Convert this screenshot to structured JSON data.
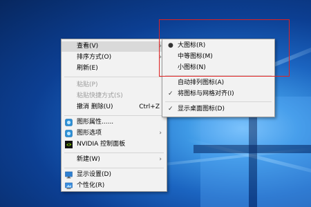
{
  "context_menu": {
    "items": [
      {
        "label": "查看(V)",
        "has_submenu": true,
        "highlighted": true
      },
      {
        "label": "排序方式(O)",
        "has_submenu": true
      },
      {
        "label": "刷新(E)"
      },
      {
        "label": "粘贴(P)",
        "disabled": true
      },
      {
        "label": "粘贴快捷方式(S)",
        "disabled": true
      },
      {
        "label": "撤消 删除(U)",
        "shortcut": "Ctrl+Z"
      },
      {
        "label": "图形属性......",
        "icon": "intel-graphics-icon"
      },
      {
        "label": "图形选项",
        "icon": "intel-graphics-icon",
        "has_submenu": true
      },
      {
        "label": "NVIDIA 控制面板",
        "icon": "nvidia-icon"
      },
      {
        "label": "新建(W)",
        "has_submenu": true
      },
      {
        "label": "显示设置(D)",
        "icon": "display-icon"
      },
      {
        "label": "个性化(R)",
        "icon": "personalize-icon"
      }
    ]
  },
  "view_submenu": {
    "items": [
      {
        "label": "大图标(R)",
        "selected": true
      },
      {
        "label": "中等图标(M)"
      },
      {
        "label": "小图标(N)"
      },
      {
        "label": "自动排列图标(A)"
      },
      {
        "label": "将图标与网格对齐(I)",
        "checked": true
      },
      {
        "label": "显示桌面图标(D)",
        "checked": true
      }
    ]
  },
  "colors": {
    "highlight_box": "#e02020",
    "menu_background": "#f2f2f2",
    "menu_hover": "#d9d9d9",
    "disabled_text": "#9b9b9b"
  }
}
